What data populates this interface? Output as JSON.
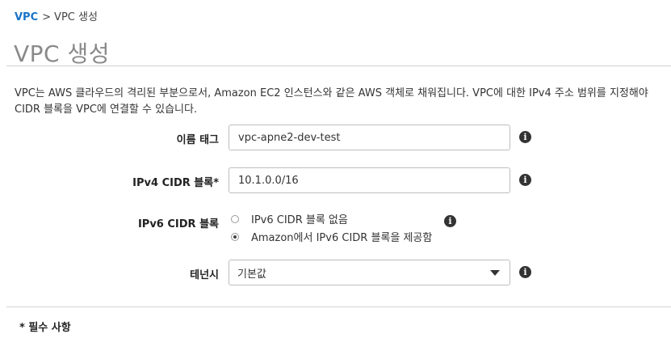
{
  "breadcrumb": {
    "root": "VPC",
    "separator": ">",
    "current": "VPC 생성"
  },
  "page_title": "VPC 생성",
  "description": {
    "line1": "VPC는 AWS 클라우드의 격리된 부분으로서, Amazon EC2 인스턴스와 같은 AWS 객체로 채워집니다. VPC에 대한 IPv4 주소 범위를 지정해야",
    "line2": "CIDR 블록을 VPC에 연결할 수 있습니다."
  },
  "form": {
    "name_tag": {
      "label": "이름 태그",
      "value": "vpc-apne2-dev-test"
    },
    "ipv4_cidr": {
      "label": "IPv4 CIDR 블록*",
      "value": "10.1.0.0/16"
    },
    "ipv6_cidr": {
      "label": "IPv6 CIDR 블록",
      "options": [
        {
          "label": "IPv6 CIDR 블록 없음",
          "selected": false
        },
        {
          "label": "Amazon에서 IPv6 CIDR 블록을 제공함",
          "selected": true
        }
      ]
    },
    "tenancy": {
      "label": "테넌시",
      "value": "기본값"
    },
    "info_glyph": "i"
  },
  "required_note": "* 필수 사항",
  "icons": {
    "info": "info-icon",
    "dropdown": "caret-down-icon"
  },
  "colors": {
    "link": "#1a73c8",
    "title": "#8a8a8a",
    "icon": "#333333"
  }
}
